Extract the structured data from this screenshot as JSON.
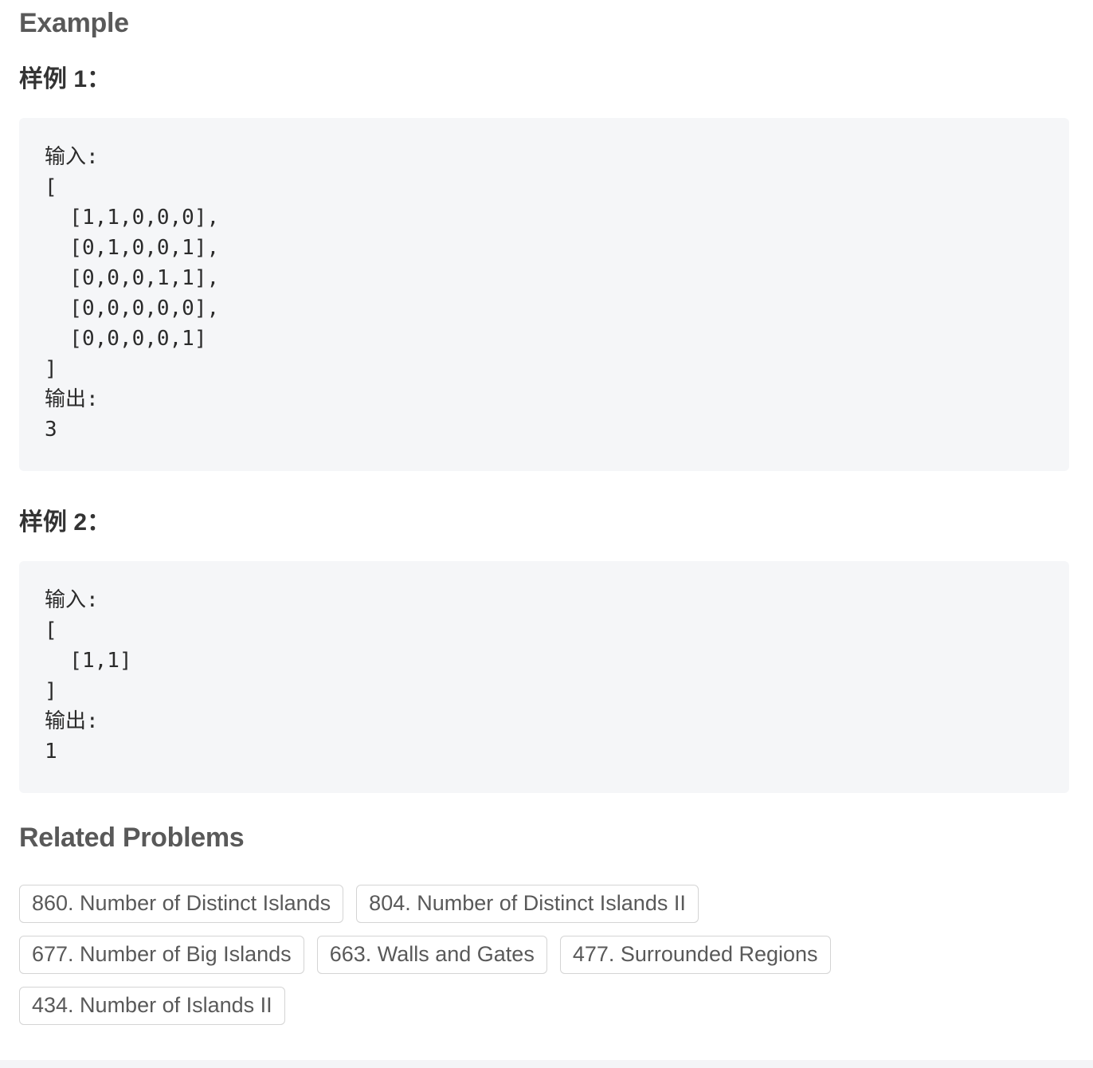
{
  "example_section": {
    "title": "Example",
    "examples": [
      {
        "label": "样例 1：",
        "code": "输入:\n[\n  [1,1,0,0,0],\n  [0,1,0,0,1],\n  [0,0,0,1,1],\n  [0,0,0,0,0],\n  [0,0,0,0,1]\n]\n输出:\n3"
      },
      {
        "label": "样例 2：",
        "code": "输入:\n[\n  [1,1]\n]\n输出:\n1"
      }
    ]
  },
  "related_section": {
    "title": "Related Problems",
    "problems": [
      "860. Number of Distinct Islands",
      "804. Number of Distinct Islands II",
      "677. Number of Big Islands",
      "663. Walls and Gates",
      "477. Surrounded Regions",
      "434. Number of Islands II"
    ]
  }
}
